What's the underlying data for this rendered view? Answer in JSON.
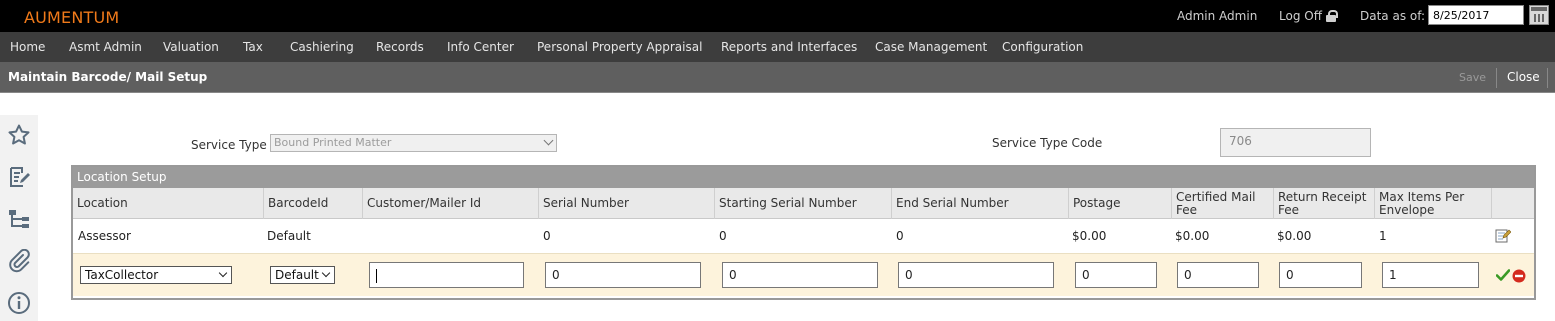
{
  "app": {
    "brand": "AUMENTUM"
  },
  "topbar": {
    "user": "Admin Admin",
    "logoff": "Log Off",
    "data_as_of_label": "Data as of:",
    "data_as_of_value": "8/25/2017"
  },
  "nav": {
    "items": [
      "Home",
      "Asmt Admin",
      "Valuation",
      "Tax",
      "Cashiering",
      "Records",
      "Info Center",
      "Personal Property Appraisal",
      "Reports and Interfaces",
      "Case Management",
      "Configuration"
    ]
  },
  "page": {
    "title": "Maintain Barcode/ Mail Setup",
    "save_label": "Save",
    "close_label": "Close"
  },
  "rail": {
    "icons": [
      "star-icon",
      "edit-document-icon",
      "hierarchy-icon",
      "paperclip-icon",
      "info-icon"
    ]
  },
  "form": {
    "service_type_label": "Service Type",
    "service_type_value": "Bound Printed Matter",
    "service_type_code_label": "Service Type Code",
    "service_type_code_value": "706"
  },
  "grid": {
    "title": "Location Setup",
    "columns": [
      "Location",
      "BarcodeId",
      "Customer/Mailer Id",
      "Serial Number",
      "Starting Serial Number",
      "End Serial Number",
      "Postage",
      "Certified Mail Fee",
      "Return Receipt Fee",
      "Max Items Per Envelope"
    ],
    "rows": [
      {
        "location": "Assessor",
        "barcode_id": "Default",
        "customer_mailer_id": "",
        "serial_number": "0",
        "starting_serial_number": "0",
        "end_serial_number": "0",
        "postage": "$0.00",
        "certified_mail_fee": "$0.00",
        "return_receipt_fee": "$0.00",
        "max_items": "1"
      }
    ],
    "edit_row": {
      "location": "TaxCollector",
      "barcode_id": "Default",
      "customer_mailer_id": "",
      "serial_number": "0",
      "starting_serial_number": "0",
      "end_serial_number": "0",
      "postage": "0",
      "certified_mail_fee": "0",
      "return_receipt_fee": "0",
      "max_items": "1"
    }
  },
  "colors": {
    "brand": "#f07a1a",
    "topbar": "#000000",
    "nav": "#3d3d3d",
    "pagebar": "#5f5f5f",
    "edit_row": "#fdf3dc"
  }
}
